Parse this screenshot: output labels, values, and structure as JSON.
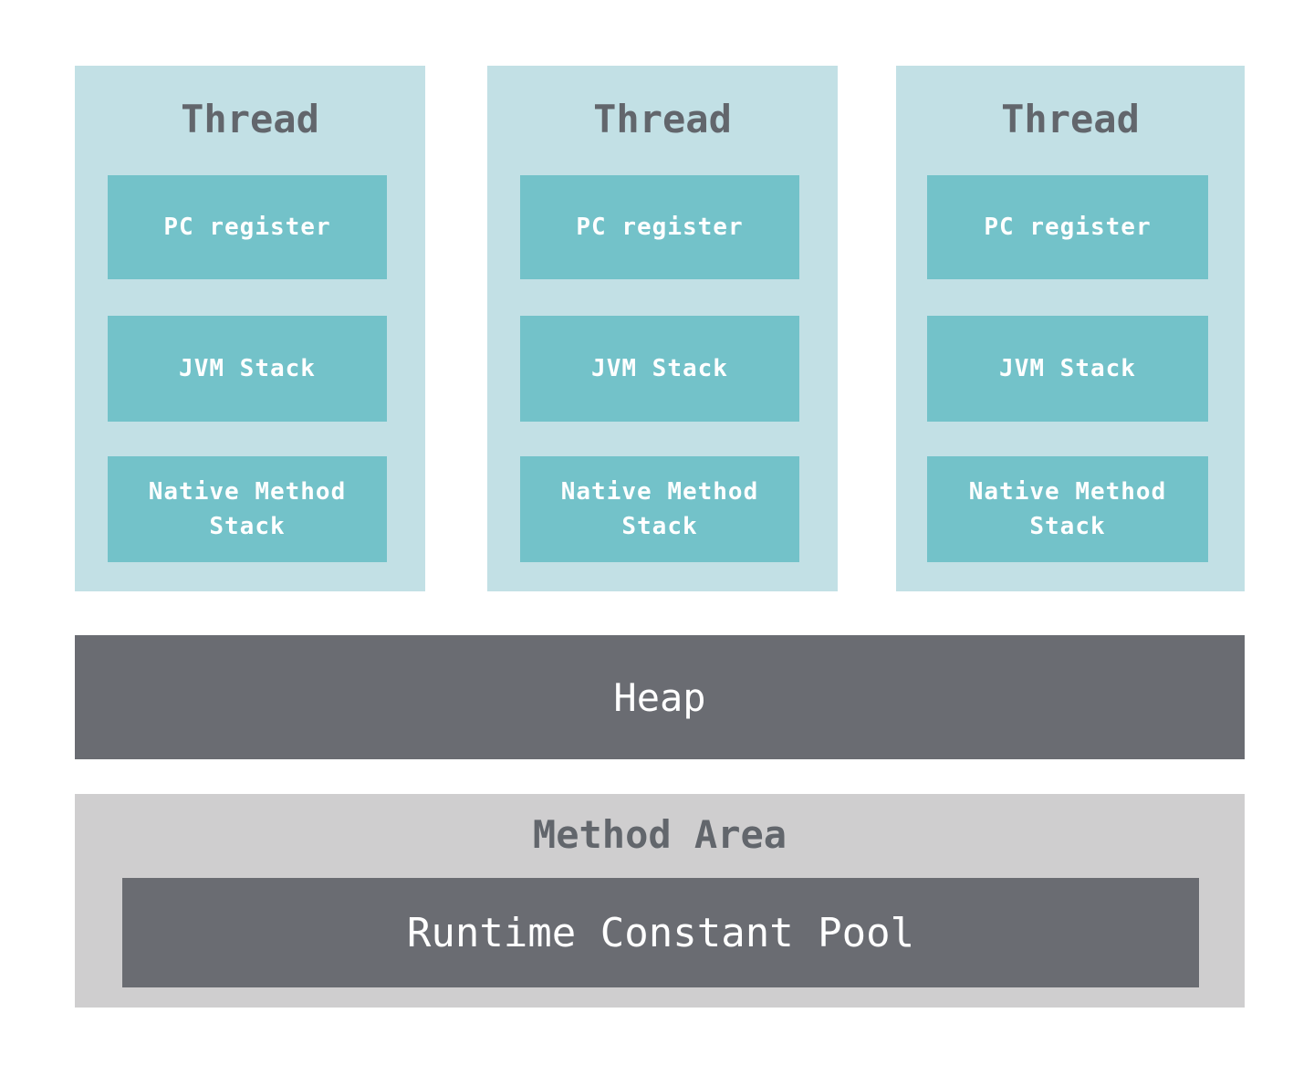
{
  "threads": [
    {
      "title": "Thread",
      "pc_register": "PC register",
      "jvm_stack": "JVM Stack",
      "native_method_stack": "Native Method Stack"
    },
    {
      "title": "Thread",
      "pc_register": "PC register",
      "jvm_stack": "JVM Stack",
      "native_method_stack": "Native Method Stack"
    },
    {
      "title": "Thread",
      "pc_register": "PC register",
      "jvm_stack": "JVM Stack",
      "native_method_stack": "Native Method Stack"
    }
  ],
  "heap": {
    "label": "Heap"
  },
  "method_area": {
    "label": "Method Area",
    "runtime_constant_pool": "Runtime Constant Pool"
  },
  "colors": {
    "thread_bg": "#c2e0e5",
    "thread_component": "#73c2c9",
    "dark": "#6a6c72",
    "method_area_bg": "#cfcecf"
  }
}
